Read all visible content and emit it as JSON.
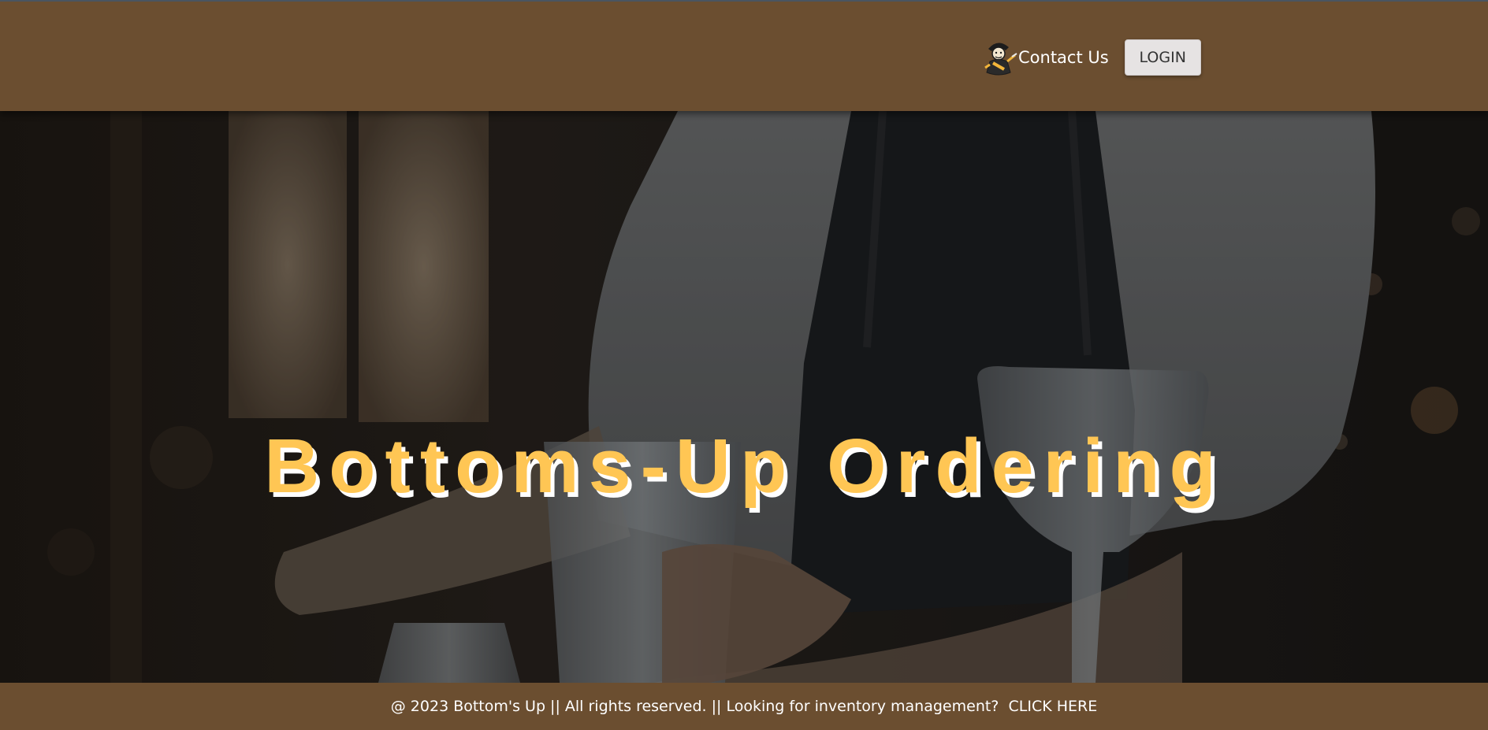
{
  "header": {
    "mascot_icon": "pirate-mascot-icon",
    "contact_label": "Contact Us",
    "login_label": "LOGIN"
  },
  "hero": {
    "title": "Bottoms-Up Ordering",
    "title_color": "#ffc654",
    "background_description_icon": "bartender-photo"
  },
  "footer": {
    "text": "@ 2023 Bottom's Up || All rights reserved. || Looking for inventory management?  ",
    "link_label": "CLICK HERE"
  },
  "colors": {
    "brand_brown": "#6b4e30",
    "accent_gold": "#ffc654"
  }
}
